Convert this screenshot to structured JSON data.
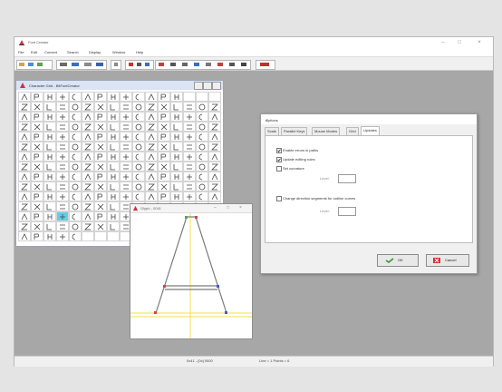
{
  "app": {
    "title": "Font Creator",
    "menu": [
      "File",
      "Edit",
      "Convert",
      "Search",
      "Display",
      "Window",
      "Help"
    ]
  },
  "char_window": {
    "title": "Character Grid - BitFontCreator"
  },
  "glyph_window": {
    "title": "Glyph - 0041"
  },
  "dialog": {
    "title": "Options",
    "close": "×",
    "tabs": [
      "Scale",
      "Parallel Keys",
      "Mouse Modes",
      "Grid",
      "Updates"
    ],
    "active_tab": "Updates",
    "options": [
      {
        "label": "Enable errors in paths",
        "checked": true
      },
      {
        "label": "Update editing rules",
        "checked": true
      },
      {
        "label": "Set curvature",
        "checked": false
      }
    ],
    "sub1_label": "Level:",
    "option4": {
      "label": "Change direction segments for outline curves",
      "checked": false
    },
    "sub2_label": "Level:",
    "ok": "OK",
    "cancel": "Cancel"
  },
  "status": {
    "left": "0x41 - [0x] 0000",
    "right": "Line = 1  Points = 6"
  },
  "colors": {
    "accent": "#2b6fd6",
    "highlight": "#5fd0e6",
    "guide": "#f5e04a",
    "glyph_stroke": "#7a7a7a",
    "point_red": "#e04040",
    "point_blue": "#4058d8"
  }
}
